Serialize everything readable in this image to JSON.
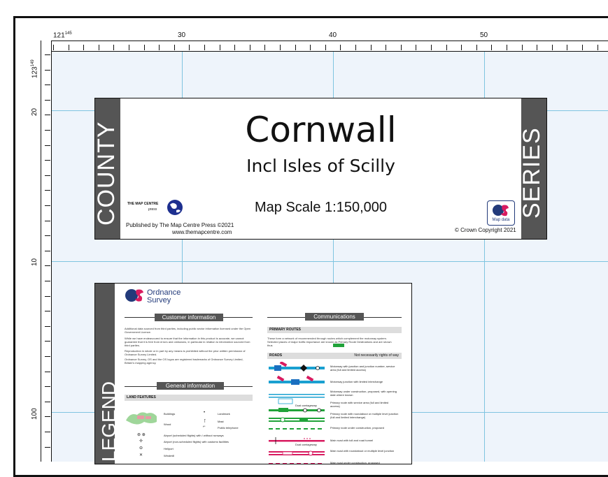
{
  "grid": {
    "top_labels": [
      "121",
      "30",
      "40",
      "50"
    ],
    "top_label_sup": "145",
    "left_labels": [
      "123",
      "20",
      "10",
      "100"
    ],
    "left_label_sup": "149",
    "grid_color": "#7fc4e0",
    "map_fill": "#eef4fb"
  },
  "title_panel": {
    "left_band": "COUNTY",
    "right_band": "SERIES",
    "title": "Cornwall",
    "subtitle": "Incl Isles of Scilly",
    "scale": "Map Scale 1:150,000",
    "publisher_logo_line1": "THE MAP CENTRE",
    "publisher_logo_line2": "press",
    "published_by": "Published by The Map Centre Press ©2021",
    "website": "www.themapcentre.com",
    "os_badge": "Map data",
    "copyright": "© Crown Copyright 2021",
    "band_color": "#555555"
  },
  "legend_panel": {
    "band_text": "LEGEND",
    "brand_line1": "Ordnance",
    "brand_line2": "Survey",
    "customer_info_title": "Customer information",
    "customer_info_p1": "Additional data sourced from third parties, including public sector information licensed under the Open Government Licence.",
    "customer_info_p2": "While we have endeavoured to ensure that the information in this product is accurate, we cannot guarantee that it is free from errors and omissions, in particular in relation to information sourced from third parties.",
    "customer_info_p3": "Reproduction in whole or in part by any means is prohibited without the prior written permission of Ordnance Survey Limited.",
    "customer_info_p4": "Ordnance Survey, OS and the OS logos are registered trademarks of Ordnance Survey Limited, Britain's mapping agency.",
    "general_info_title": "General information",
    "land_features": "LAND FEATURES",
    "lf_buildings": "Buildings",
    "lf_wood": "Wood",
    "lf_landmark": "Landmark",
    "lf_mast": "Mast",
    "lf_phone": "Public telephone",
    "lf_airport1": "Airport (scheduled flights) with / without runways",
    "lf_airport2": "Airport (non-scheduled flights) with customs facilities",
    "lf_heliport": "Heliport",
    "lf_windmill": "Windmill",
    "communications_title": "Communications",
    "primary_routes": "PRIMARY ROUTES",
    "primary_text": "These form a network of recommended through routes which complement the motorway system. Selected places of major traffic importance are known as Primary Route Destinations and are shown thus",
    "roads": "ROADS",
    "roads_note": "Not necessarily rights of way",
    "road1": "Motorway with junction and junction number, service area (full and limited access)",
    "road2": "Motorway junction with limited interchange",
    "road3": "Motorway under construction, proposed, with opening date where known",
    "road4": "Primary route with service area (full and limited access)",
    "road5": "Primary route with roundabout or multiple level junction (full and limited interchange)",
    "road6": "Primary route under construction, proposed",
    "road7": "Main road with toll and road tunnel",
    "road8": "Main road with roundabout or multiple level junction",
    "road9": "Main road under construction, proposed",
    "dual1": "Dual carriageway",
    "dual2": "Dual carriageway"
  }
}
